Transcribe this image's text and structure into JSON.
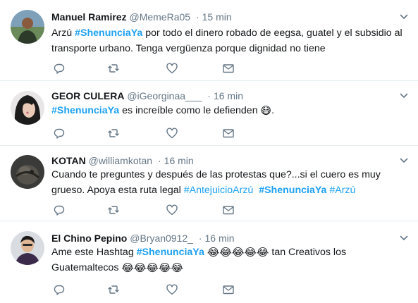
{
  "tweets": [
    {
      "fullname": "Manuel Ramirez",
      "username": "@MemeRa05",
      "separator": "·",
      "time": "15 min",
      "segments": [
        {
          "t": "Arzú "
        },
        {
          "h": "#ShenunciaYa",
          "bold": true
        },
        {
          "t": " por todo el dinero robado de eegsa, guatel y el subsidio al transporte urbano. Tenga vergüenza porque dignidad no tiene"
        }
      ]
    },
    {
      "fullname": "GEOR CULERA",
      "username": "@iGeorginaa___",
      "separator": "·",
      "time": "16 min",
      "segments": [
        {
          "h": "#ShenunciaYa",
          "bold": true
        },
        {
          "t": " es increíble como le defienden "
        },
        {
          "e": "😷"
        },
        {
          "t": "."
        }
      ]
    },
    {
      "fullname": "KOTAN",
      "username": "@williamkotan",
      "separator": "·",
      "time": "16 min",
      "segments": [
        {
          "t": "Cuando te preguntes y después de las protestas que?...si el cuero es muy grueso. Apoya esta ruta legal "
        },
        {
          "h": "#AntejuicioArzú",
          "bold": false
        },
        {
          "t": "  "
        },
        {
          "h": "#ShenunciaYa",
          "bold": true
        },
        {
          "t": " "
        },
        {
          "h": "#Arzú",
          "bold": false
        }
      ]
    },
    {
      "fullname": "El Chino Pepino",
      "username": "@Bryan0912_",
      "separator": "·",
      "time": "16 min",
      "segments": [
        {
          "t": "Ame este Hashtag "
        },
        {
          "h": "#ShenunciaYa",
          "bold": true
        },
        {
          "t": " "
        },
        {
          "e": "😂😂😂😂😂"
        },
        {
          "t": " tan Creativos los Guatemaltecos "
        },
        {
          "e": "😂😂😂😂😂"
        }
      ]
    }
  ],
  "icons": {
    "reply": "reply-icon",
    "retweet": "retweet-icon",
    "like": "heart-icon",
    "dm": "envelope-icon",
    "more": "chevron-down-icon"
  },
  "colors": {
    "hashtag": "#1da1f2",
    "secondary_text": "#657786",
    "action_icon": "#657786",
    "divider": "#e6ecf0"
  }
}
